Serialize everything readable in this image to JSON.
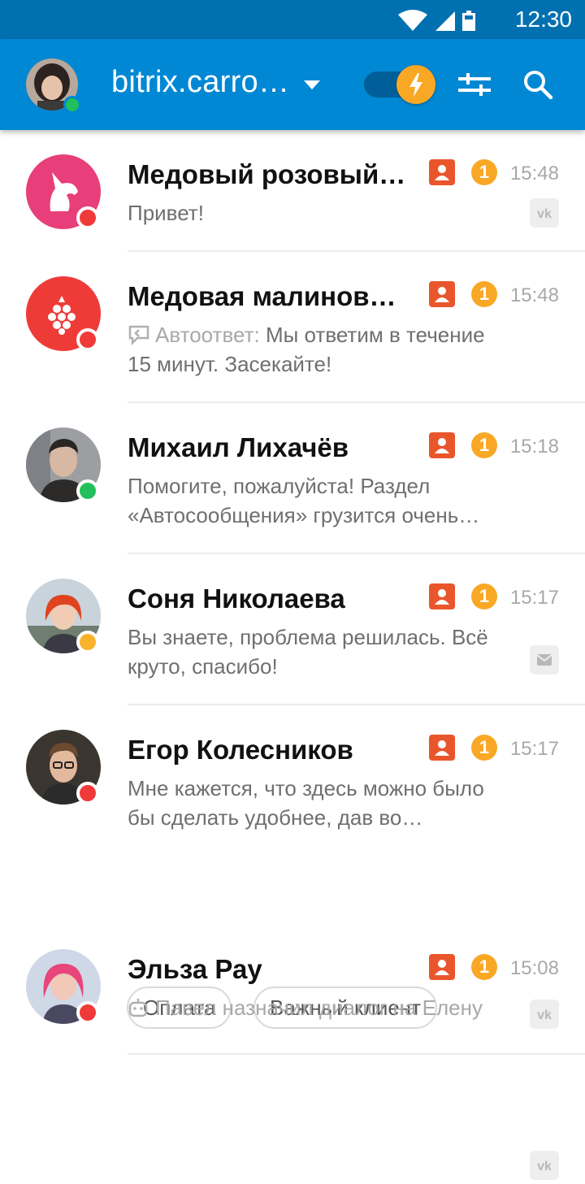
{
  "status_bar": {
    "time": "12:30"
  },
  "header": {
    "portal_name": "bitrix.carro…",
    "icons": [
      "wifi-icon",
      "signal-icon",
      "battery-icon",
      "caret-down-icon",
      "lightning-icon",
      "filter-icon",
      "search-icon"
    ],
    "toggle_on": true
  },
  "colors": {
    "app_bar": "#0088d4",
    "status_bar": "#0070b0",
    "badge": "#f9a825",
    "crm": "#e9562c"
  },
  "chats": [
    {
      "name": "Медовый розовый…",
      "preview": "Привет!",
      "time": "15:48",
      "unread": "1",
      "status": "red",
      "source": "vk"
    },
    {
      "name": "Медовая малинов…",
      "preview_prefix": "Автоответ:",
      "preview": "Мы ответим в течение 15 минут. Засекайте!",
      "time": "15:48",
      "unread": "1",
      "status": "red"
    },
    {
      "name": "Михаил Лихачёв",
      "preview": "Помогите, пожалуйста! Раздел «Автосообщения» грузится очень…",
      "time": "15:18",
      "unread": "1",
      "status": "green"
    },
    {
      "name": "Соня Николаева",
      "preview": "Вы знаете, проблема решилась. Всё круто, спасибо!",
      "time": "15:17",
      "unread": "1",
      "status": "yellow",
      "source": "email"
    },
    {
      "name": "Егор Колесников",
      "preview": "Мне кажется, что здесь можно было бы сделать удобнее, дав во…",
      "time": "15:17",
      "unread": "1",
      "status": "red",
      "tags": [
        "Оплата",
        "Важный клиент"
      ],
      "source": "vk"
    },
    {
      "name": "Эльза Рау",
      "preview": "Павел назначил диалог на Елену",
      "time": "15:08",
      "unread": "1",
      "status": "red",
      "source": "vk"
    }
  ]
}
